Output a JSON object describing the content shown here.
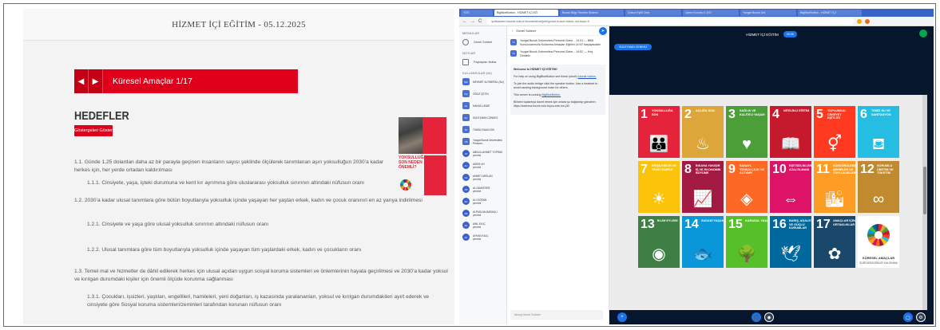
{
  "left_doc": {
    "header_title": "HİZMET İÇİ EĞİTİM - 05.12.2025",
    "section_title": "Küresel Amaçlar 1/17",
    "prev_arrow": "◀",
    "next_arrow": "▶",
    "heading": "HEDEFLER",
    "goal_button": "Göstergeleri Göster",
    "photo_caption": "YOKSULLUĞA SON NEDEN ÖNEMLİ?",
    "paragraphs": [
      "1.1. Günde 1,25 dolardan daha az bir parayla geçinen insanların sayısı şeklinde ölçülerek tanımlanan aşırı yoksulluğun 2030’a kadar herkes için, her yerde ortadan kaldırılması",
      "1.1.1. Cinsiyete, yaşa, işteki durumuna ve kent kır ayrımına göre uluslararası yoksulluk sınırının altındaki nüfusun oranı",
      "1.2. 2030’a kadar ulusal tanımlara göre bütün boyutlarıyla yoksulluk içinde yaşayan her yaştan erkek, kadın ve çocuk oranının en az yarıya indirilmesi",
      "1.2.1. Cinsiyete ve yaşa göre ulusal yoksulluk sınırının altındaki nüfusun oranı",
      "1.2.2. Ulusal tanımlara göre tüm boyutlarıyla yoksulluk içinde yaşayan tüm yaşlardaki erkek, kadın ve çocukların oranı",
      "1.3. Temel mal ve hizmetler de dâhil edilerek herkes için ulusal açıdan uygun sosyal koruma sistemleri ve önlemlerinin hayata geçirilmesi ve 2030’a kadar yoksul ve kırılgan durumdaki kişiler için önemli ölçüde korunma sağlanması",
      "1.3.1. Çocukları, işsizleri, yaşlıları, engellileri, hamileleri, yeni doğanları, iş kazasında yaralananları, yoksul ve kırılgan durumdakileri ayırt ederek ve cinsiyete göre Sosyal koruma sistemleri/zeminleri tarafından korunan nüfusun oranı"
    ]
  },
  "browser": {
    "tabs": [
      "YÖS",
      "BigBlueButton - HİZMET İÇİ EĞ",
      "Bozok Bilgi Yönetim Sistemi",
      "Dokuz Eylül Üniv",
      "Uzem Konusu 1.5/17",
      "Yozgat Bozok Üni",
      "BigBlueButton - HİZMET İÇİ"
    ],
    "url": "yobsuzem.bozok.edu.tr/rooms/hmn/join/gonul-kusur-fokon-ozl-koyu-0",
    "nav_back": "←",
    "nav_forward": "→",
    "nav_reload": "C"
  },
  "bbb_sidebar": {
    "messages_header": "MESAJLAR",
    "public_chat": "Genel Sohbet",
    "notes_header": "NOTLAR",
    "shared_notes": "Paylaşılan Notlar",
    "users_header": "KULLANICILAR (44)",
    "users": [
      {
        "initials": "MA",
        "name": "MEHMET ALTINERAL (Siz)"
      },
      {
        "initials": "OÇ",
        "name": "OĞUZ ÇETİN"
      },
      {
        "initials": "HL",
        "name": "HAKAN LİNDE"
      },
      {
        "initials": "SC",
        "name": "SÜLEYMAN CENKEZ"
      },
      {
        "initials": "TK",
        "name": "TUBAN KAAN IZIK"
      },
      {
        "initials": "YB",
        "name": "Yozgat Bozok Üniversitesi Persone..."
      },
      {
        "initials": "AT",
        "name": "ABDULLAHMET TOPRAK\nçevrimi"
      },
      {
        "initials": "AU",
        "name": "ADEM UH\nçevrimi"
      },
      {
        "initials": "AA",
        "name": "AHMET ARSLAN\nçevrimi"
      },
      {
        "initials": "AB",
        "name": "ALİ BAHATİER\nçevrimi"
      },
      {
        "initials": "AD",
        "name": "ALİ DOĞAN\nçevrimi"
      },
      {
        "initials": "AB",
        "name": "ALPASLAN BARAKLI\nçevrimi"
      },
      {
        "initials": "AK",
        "name": "ANIL KILIÇ\nçevrimi"
      },
      {
        "initials": "AK",
        "name": "AYHAN KILIÇ\nçevrimi"
      }
    ]
  },
  "bbb_chat": {
    "title": "Genel Sohbet",
    "back": "‹",
    "messages": [
      {
        "initials": "Yo",
        "text": "Yozgat Bozok Üniversitesi Personel Daire... 14:01 — BBB Sunucularımızla Kullanma Amaçları Eğitimi 14:00’ başlayacaktır"
      },
      {
        "initials": "Yo",
        "text": "Yozgat Bozok Üniversitesi Personel Daire... 14:02 — Hoş Geldiniz"
      }
    ],
    "welcome_title": "Welcome to HİZMET İÇİ EĞİTİM!",
    "welcome_p1": "For help on using BigBlueButton see these (short)",
    "welcome_link1": "tutorial videos.",
    "welcome_p2": "To join the audio bridge click the speaker button. Use a headset to avoid causing background noise for others.",
    "welcome_p3": "This server is running",
    "welcome_link2": "BigBlueButton.",
    "welcome_p4": "Bilinleri toplantıya davet etmek için onlara şu bağlantıyı gönderin:",
    "welcome_link3": "https://sctezna.bozok.edu.tr/you-ede-hw-j30",
    "input_placeholder": "Mesaj Genel Sohbet",
    "send": "➤"
  },
  "bbb_stage": {
    "title": "HİZMET İÇİ EĞİTİM",
    "rec": "00:36",
    "presenter": "SÜLEYMAN CENKEZ",
    "sdg_tiles": [
      {
        "n": "1",
        "label": "YOKSULLUĞA SON",
        "color": "#e5243b",
        "glyph": "👪"
      },
      {
        "n": "2",
        "label": "AÇLIĞA SON",
        "color": "#dda63a",
        "glyph": "♨"
      },
      {
        "n": "3",
        "label": "SAĞLIK VE KALİTELİ YAŞAM",
        "color": "#4c9f38",
        "glyph": "♥"
      },
      {
        "n": "4",
        "label": "NİTELİKLİ EĞİTİM",
        "color": "#c5192d",
        "glyph": "📖"
      },
      {
        "n": "5",
        "label": "TOPLUMSAL CİNSİYET EŞİTLİĞİ",
        "color": "#ff3a21",
        "glyph": "⚥"
      },
      {
        "n": "6",
        "label": "TEMİZ SU VE SANİTASYON",
        "color": "#26bde2",
        "glyph": "⛾"
      },
      {
        "n": "7",
        "label": "ERİŞİLEBİLİR VE TEMİZ ENERJİ",
        "color": "#fcc30b",
        "glyph": "☀"
      },
      {
        "n": "8",
        "label": "İNSANA YAKIŞIR İŞ VE EKONOMİK BÜYÜME",
        "color": "#a21942",
        "glyph": "📈"
      },
      {
        "n": "9",
        "label": "SANAYİ, YENİLİKÇİLİK VE ALTYAPI",
        "color": "#fd6925",
        "glyph": "◈"
      },
      {
        "n": "10",
        "label": "EŞİTSİZLİKLERİN AZALTILMASI",
        "color": "#dd1367",
        "glyph": "⇔"
      },
      {
        "n": "11",
        "label": "SÜRDÜRÜLEBİLİR ŞEHİRLER VE TOPLULUKLAR",
        "color": "#fd9d24",
        "glyph": "🏙"
      },
      {
        "n": "12",
        "label": "SORUMLU ÜRETİM VE TÜKETİM",
        "color": "#bf8b2e",
        "glyph": "∞"
      },
      {
        "n": "13",
        "label": "İKLİM EYLEMİ",
        "color": "#3f7e44",
        "glyph": "◉"
      },
      {
        "n": "14",
        "label": "SUDAKİ YAŞAM",
        "color": "#0a97d9",
        "glyph": "🐟"
      },
      {
        "n": "15",
        "label": "KARASAL YAŞAM",
        "color": "#56c02b",
        "glyph": "🌳"
      },
      {
        "n": "16",
        "label": "BARIŞ, ADALET VE GÜÇLÜ KURUMLAR",
        "color": "#00689d",
        "glyph": "🕊"
      },
      {
        "n": "17",
        "label": "AMAÇLAR İÇİN ORTAKLIKLAR",
        "color": "#19486a",
        "glyph": "✿"
      }
    ],
    "logo_caption": "KÜRESEL AMAÇLAR",
    "logo_sub": "SÜRDÜRÜLEBİLİR KALKINMA"
  }
}
